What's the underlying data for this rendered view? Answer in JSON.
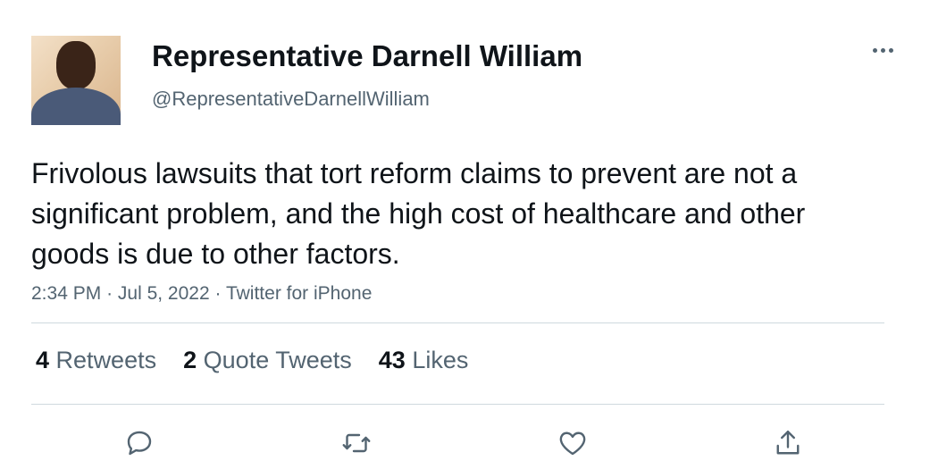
{
  "author": {
    "name": "Representative Darnell William",
    "handle": "@RepresentativeDarnellWilliam",
    "avatar_icon": "profile-photo"
  },
  "tweet": {
    "text": "Frivolous lawsuits that tort reform claims to prevent are not a significant problem, and the high cost of healthcare and other goods is due to other factors.",
    "time": "2:34 PM",
    "date": "Jul 5, 2022",
    "source": "Twitter for iPhone",
    "separator": "·"
  },
  "stats": [
    {
      "count": "4",
      "label": "Retweets"
    },
    {
      "count": "2",
      "label": "Quote Tweets"
    },
    {
      "count": "43",
      "label": "Likes"
    }
  ],
  "actions": [
    {
      "name": "reply",
      "icon": "reply-icon"
    },
    {
      "name": "retweet",
      "icon": "retweet-icon"
    },
    {
      "name": "like",
      "icon": "heart-icon"
    },
    {
      "name": "share",
      "icon": "share-icon"
    }
  ],
  "colors": {
    "primary_text": "#0f1419",
    "secondary_text": "#536471",
    "divider": "#cfd9de"
  }
}
